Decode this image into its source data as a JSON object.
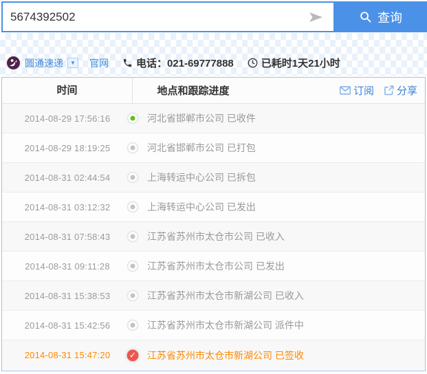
{
  "search": {
    "query_value": "5674392502",
    "button_label": "查询"
  },
  "courier": {
    "name": "圆通速递",
    "website_label": "官网",
    "phone_text": "电话：021-69777888",
    "elapsed_text": "已耗时1天21小时"
  },
  "table": {
    "header_time": "时间",
    "header_progress": "地点和跟踪进度",
    "subscribe_label": "订阅",
    "share_label": "分享",
    "rows": [
      {
        "time": "2014-08-29 17:56:16",
        "status": "河北省邯郸市公司 已收件",
        "dot": "green",
        "highlight": false
      },
      {
        "time": "2014-08-29 18:19:25",
        "status": "河北省邯郸市公司 已打包",
        "dot": "gray",
        "highlight": false
      },
      {
        "time": "2014-08-31 02:44:54",
        "status": "上海转运中心公司 已拆包",
        "dot": "gray",
        "highlight": false
      },
      {
        "time": "2014-08-31 03:12:32",
        "status": "上海转运中心公司 已发出",
        "dot": "gray",
        "highlight": false
      },
      {
        "time": "2014-08-31 07:58:43",
        "status": "江苏省苏州市太仓市公司 已收入",
        "dot": "gray",
        "highlight": false
      },
      {
        "time": "2014-08-31 09:11:28",
        "status": "江苏省苏州市太仓市公司 已发出",
        "dot": "gray",
        "highlight": false
      },
      {
        "time": "2014-08-31 15:38:53",
        "status": "江苏省苏州市太仓市新湖公司 已收入",
        "dot": "gray",
        "highlight": false
      },
      {
        "time": "2014-08-31 15:42:56",
        "status": "江苏省苏州市太仓市新湖公司 派件中",
        "dot": "gray",
        "highlight": false
      },
      {
        "time": "2014-08-31 15:47:20",
        "status": "江苏省苏州市太仓市新湖公司 已签收",
        "dot": "red-check",
        "highlight": true
      }
    ]
  },
  "colors": {
    "accent_blue": "#4a90e2",
    "button_blue": "#4b91e8",
    "link_blue": "#4089dc",
    "table_border_blue": "#9fc3e9",
    "pattern_blue": "#e9f1fb",
    "green_dot": "#5fc30d",
    "red_check": "#eb5751",
    "highlight_orange": "#ff8800",
    "logo_purple": "#4f2249"
  },
  "icons": {
    "send": "send-icon",
    "magnifier": "search-icon",
    "phone": "phone-icon",
    "clock": "clock-icon",
    "envelope": "envelope-icon",
    "share": "share-icon",
    "caret": "▼"
  }
}
